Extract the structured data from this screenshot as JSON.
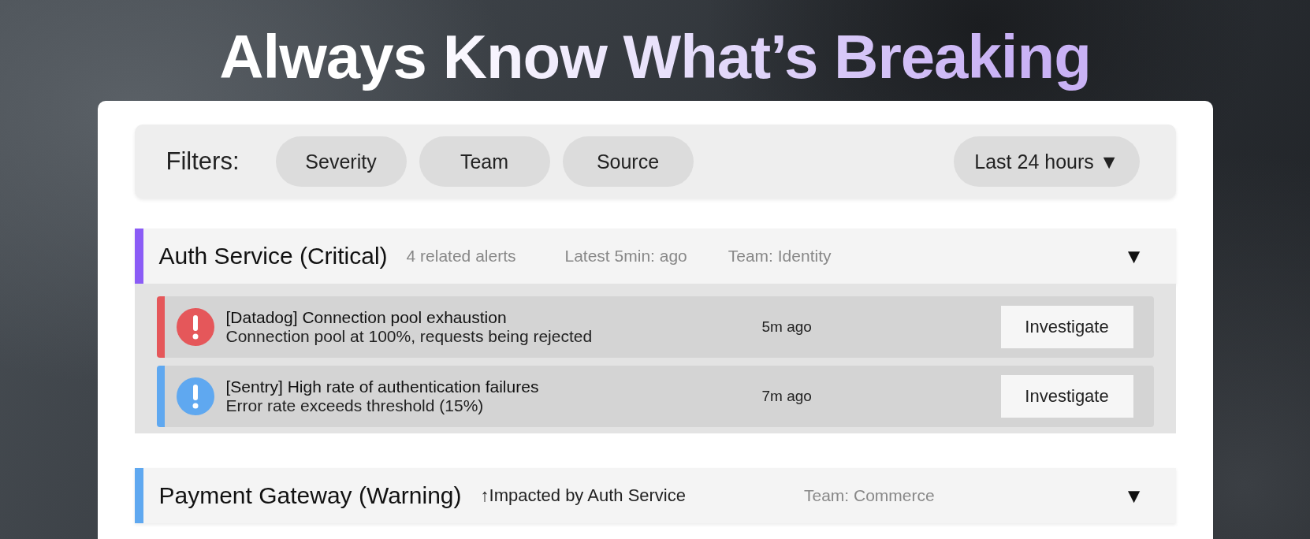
{
  "headline": "Always Know What’s Breaking",
  "filters": {
    "label": "Filters:",
    "chips": [
      "Severity",
      "Team",
      "Source"
    ],
    "range": "Last 24 hours",
    "caret": "▼"
  },
  "groups": [
    {
      "title": "Auth Service (Critical)",
      "color": "#8b5cf6",
      "meta": [
        "4 related alerts",
        "Latest 5min: ago",
        "Team: Identity"
      ],
      "caret": "▼",
      "alerts": [
        {
          "title": "[Datadog] Connection pool exhaustion",
          "detail": "Connection pool at 100%, requests being rejected",
          "time": "5m ago",
          "color": "#e5575a",
          "action": "Investigate"
        },
        {
          "title": "[Sentry] High rate of authentication failures",
          "detail": "Error rate exceeds threshold (15%)",
          "time": "7m ago",
          "color": "#5fa8f0",
          "action": "Investigate"
        }
      ]
    },
    {
      "title": "Payment Gateway (Warning)",
      "color": "#5fa8f0",
      "impact": "↑Impacted by Auth Service",
      "meta": [
        "Team: Commerce"
      ],
      "caret": "▼"
    }
  ]
}
